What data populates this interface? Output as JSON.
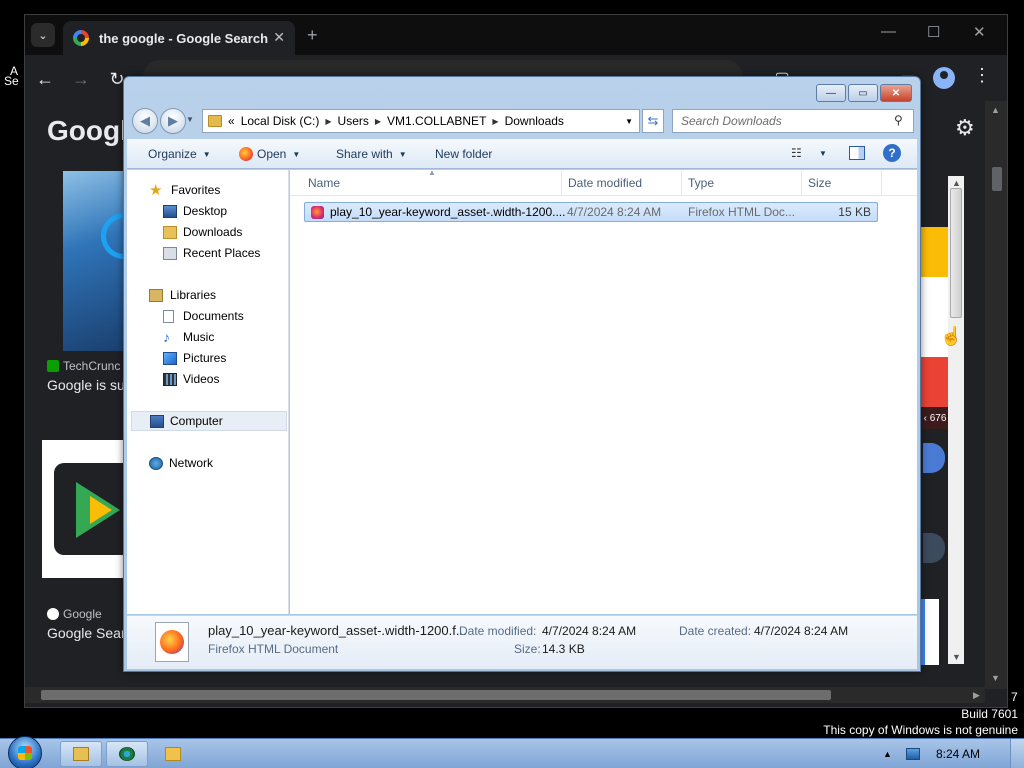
{
  "chrome": {
    "tab_title": "the google - Google Search",
    "tab_close": "✕",
    "new_tab": "+",
    "minimize": "—",
    "maximize": "☐",
    "close": "✕",
    "back": "←",
    "forward": "→",
    "reload": "↻",
    "menu": "⋮",
    "tab_list": "⌄",
    "logo_text": "Googl",
    "settings_icon": "gear-icon",
    "card1_source": "TechCrunc",
    "card1_title": "Google is su",
    "card2_source": "Google",
    "card2_title": "Google Sear",
    "side_label": "‹ 676"
  },
  "desktop": {
    "corner_a": "A",
    "corner_b": "Se",
    "build_digit": "7",
    "build": "Build 7601",
    "genuine": "This copy of Windows is not genuine"
  },
  "explorer": {
    "title_buttons": {
      "minimize": "—",
      "maximize": "▭",
      "close": "✕"
    },
    "breadcrumb": [
      "Local Disk (C:)",
      "Users",
      "VM1.COLLABNET",
      "Downloads"
    ],
    "breadcrumb_prefix": "«",
    "search_placeholder": "Search Downloads",
    "commands": {
      "organize": "Organize",
      "open": "Open",
      "share_with": "Share with",
      "new_folder": "New folder"
    },
    "nav": {
      "favorites": "Favorites",
      "desktop": "Desktop",
      "downloads": "Downloads",
      "recent_places": "Recent Places",
      "libraries": "Libraries",
      "documents": "Documents",
      "music": "Music",
      "pictures": "Pictures",
      "videos": "Videos",
      "computer": "Computer",
      "network": "Network"
    },
    "columns": [
      "Name",
      "Date modified",
      "Type",
      "Size"
    ],
    "files": [
      {
        "name": "play_10_year-keyword_asset-.width-1200....",
        "date_modified": "4/7/2024 8:24 AM",
        "type": "Firefox HTML Doc...",
        "size": "15 KB"
      }
    ],
    "details": {
      "name": "play_10_year-keyword_asset-.width-1200.f...",
      "type": "Firefox HTML Document",
      "date_modified_label": "Date modified:",
      "date_modified": "4/7/2024 8:24 AM",
      "date_created_label": "Date created:",
      "date_created": "4/7/2024 8:24 AM",
      "size_label": "Size:",
      "size": "14.3 KB"
    }
  },
  "taskbar": {
    "clock": "8:24 AM"
  }
}
